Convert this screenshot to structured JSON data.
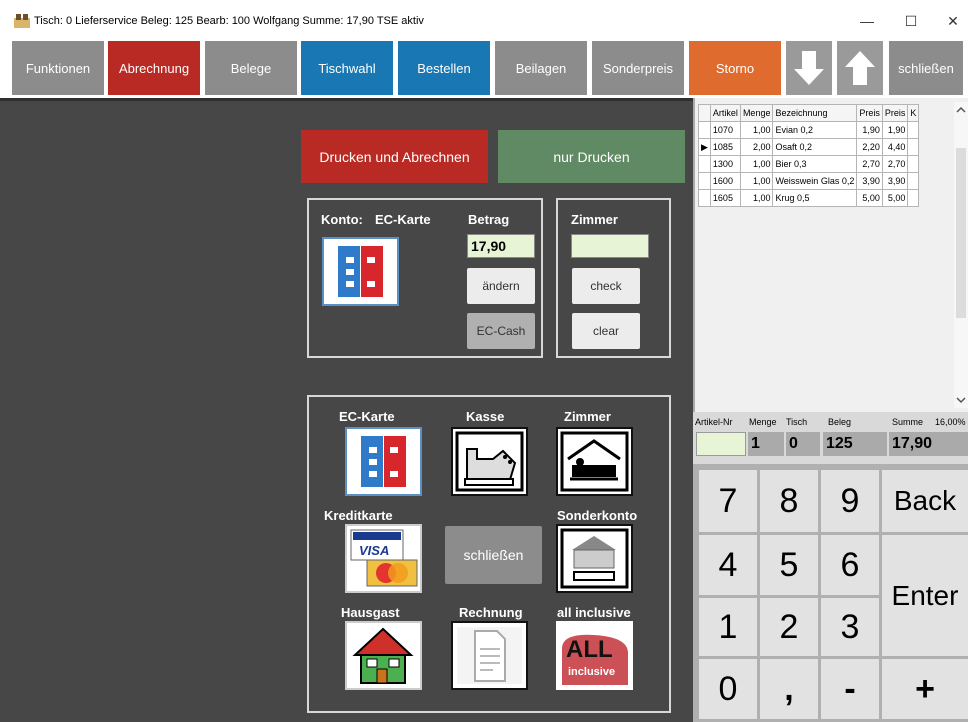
{
  "window": {
    "title": "Tisch: 0 Lieferservice  Beleg: 125  Bearb: 100 Wolfgang  Summe: 17,90    TSE aktiv",
    "minimize": "—",
    "maximize": "☐",
    "close": "✕"
  },
  "toolbar": {
    "funktionen": "Funktionen",
    "abrechnung": "Abrechnung",
    "belege": "Belege",
    "tischwahl": "Tischwahl",
    "bestellen": "Bestellen",
    "beilagen": "Beilagen",
    "sonderpreis": "Sonderpreis",
    "storno": "Storno",
    "schliessen": "schließen"
  },
  "actions": {
    "drucken_abrechnen": "Drucken und Abrechnen",
    "nur_drucken": "nur Drucken"
  },
  "payment": {
    "konto_label": "Konto:",
    "konto_value": "EC-Karte",
    "betrag_label": "Betrag",
    "betrag_value": "17,90",
    "aendern": "ändern",
    "ec_cash": "EC-Cash",
    "zimmer_label": "Zimmer",
    "zimmer_value": "",
    "check": "check",
    "clear": "clear"
  },
  "methods": {
    "ec_karte": "EC-Karte",
    "kasse": "Kasse",
    "zimmer": "Zimmer",
    "kreditkarte": "Kreditkarte",
    "schliessen": "schließen",
    "sonderkonto": "Sonderkonto",
    "hausgast": "Hausgast",
    "rechnung": "Rechnung",
    "all_inclusive": "all inclusive",
    "all_logo_big": "ALL",
    "all_logo_small": "inclusive",
    "visa": "VISA"
  },
  "items": {
    "columns": [
      "Artikel",
      "Menge",
      "Bezeichnung",
      "Preis",
      "Preis",
      "K"
    ],
    "rows": [
      {
        "artikel": "1070",
        "menge": "1,00",
        "bez": "Evian 0,2",
        "preis": "1,90",
        "preis2": "1,90"
      },
      {
        "artikel": "1085",
        "menge": "2,00",
        "bez": "Osaft  0,2",
        "preis": "2,20",
        "preis2": "4,40"
      },
      {
        "artikel": "1300",
        "menge": "1,00",
        "bez": "Bier 0,3",
        "preis": "2,70",
        "preis2": "2,70"
      },
      {
        "artikel": "1600",
        "menge": "1,00",
        "bez": "Weisswein Glas 0,2",
        "preis": "3,90",
        "preis2": "3,90"
      },
      {
        "artikel": "1605",
        "menge": "1,00",
        "bez": "Krug 0,5",
        "preis": "5,00",
        "preis2": "5,00"
      }
    ]
  },
  "summary": {
    "artikel_nr_label": "Artikel-Nr",
    "menge_label": "Menge",
    "tisch_label": "Tisch",
    "beleg_label": "Beleg",
    "summe_label": "Summe",
    "mwst_label": "16,00%",
    "artikel_nr": "",
    "menge": "1",
    "tisch": "0",
    "beleg": "125",
    "summe": "17,90"
  },
  "keypad": {
    "k7": "7",
    "k8": "8",
    "k9": "9",
    "back": "Back",
    "k4": "4",
    "k5": "5",
    "k6": "6",
    "enter": "Enter",
    "k1": "1",
    "k2": "2",
    "k3": "3",
    "k0": "0",
    "comma": ",",
    "minus": "-",
    "plus": "+"
  }
}
